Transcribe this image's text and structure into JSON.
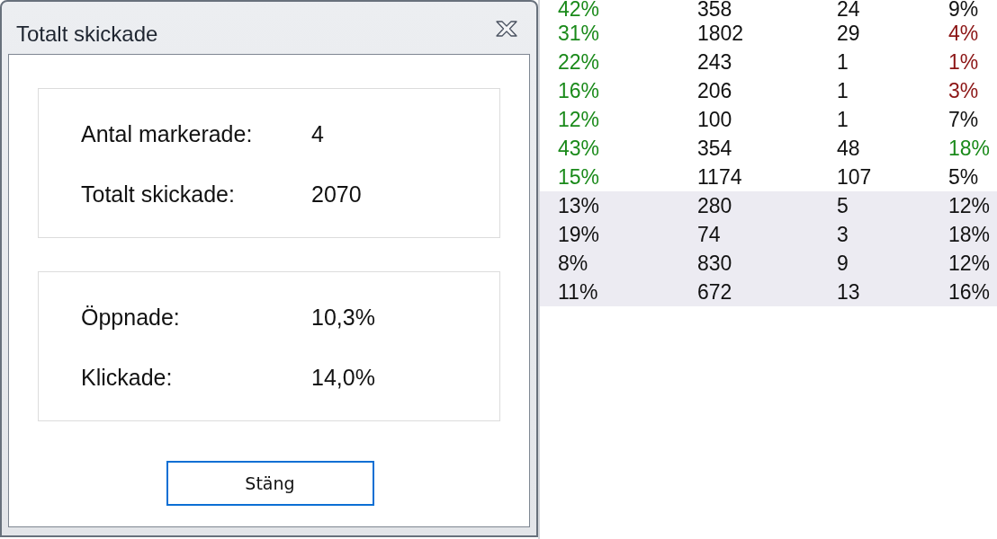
{
  "dialog": {
    "title": "Totalt skickade",
    "groups": [
      {
        "fields": [
          {
            "label": "Antal markerade:",
            "value": "4"
          },
          {
            "label": "Totalt skickade:",
            "value": "2070"
          }
        ]
      },
      {
        "fields": [
          {
            "label": "Öppnade:",
            "value": "10,3%"
          },
          {
            "label": "Klickade:",
            "value": "14,0%"
          }
        ]
      }
    ],
    "buttons": [
      {
        "label": "Stäng",
        "focused": true
      }
    ]
  },
  "table": {
    "rows": [
      {
        "selected": false,
        "cells": [
          {
            "text": "42%",
            "color": "#1a8a1a"
          },
          {
            "text": "358",
            "color": "#111111"
          },
          {
            "text": "24",
            "color": "#111111"
          },
          {
            "text": "9%",
            "color": "#111111"
          }
        ]
      },
      {
        "selected": false,
        "cells": [
          {
            "text": "31%",
            "color": "#1a8a1a"
          },
          {
            "text": "1802",
            "color": "#111111"
          },
          {
            "text": "29",
            "color": "#111111"
          },
          {
            "text": "4%",
            "color": "#8b1414"
          }
        ]
      },
      {
        "selected": false,
        "cells": [
          {
            "text": "22%",
            "color": "#1a8a1a"
          },
          {
            "text": "243",
            "color": "#111111"
          },
          {
            "text": "1",
            "color": "#111111"
          },
          {
            "text": "1%",
            "color": "#8b1414"
          }
        ]
      },
      {
        "selected": false,
        "cells": [
          {
            "text": "16%",
            "color": "#1a8a1a"
          },
          {
            "text": "206",
            "color": "#111111"
          },
          {
            "text": "1",
            "color": "#111111"
          },
          {
            "text": "3%",
            "color": "#8b1414"
          }
        ]
      },
      {
        "selected": false,
        "cells": [
          {
            "text": "12%",
            "color": "#1a8a1a"
          },
          {
            "text": "100",
            "color": "#111111"
          },
          {
            "text": "1",
            "color": "#111111"
          },
          {
            "text": "7%",
            "color": "#111111"
          }
        ]
      },
      {
        "selected": false,
        "cells": [
          {
            "text": "43%",
            "color": "#1a8a1a"
          },
          {
            "text": "354",
            "color": "#111111"
          },
          {
            "text": "48",
            "color": "#111111"
          },
          {
            "text": "18%",
            "color": "#1a8a1a"
          }
        ]
      },
      {
        "selected": false,
        "cells": [
          {
            "text": "15%",
            "color": "#1a8a1a"
          },
          {
            "text": "1174",
            "color": "#111111"
          },
          {
            "text": "107",
            "color": "#111111"
          },
          {
            "text": "5%",
            "color": "#111111"
          }
        ]
      },
      {
        "selected": true,
        "cells": [
          {
            "text": "13%",
            "color": "#111111"
          },
          {
            "text": "280",
            "color": "#111111"
          },
          {
            "text": "5",
            "color": "#111111"
          },
          {
            "text": "12%",
            "color": "#111111"
          }
        ]
      },
      {
        "selected": true,
        "cells": [
          {
            "text": "19%",
            "color": "#111111"
          },
          {
            "text": "74",
            "color": "#111111"
          },
          {
            "text": "3",
            "color": "#111111"
          },
          {
            "text": "18%",
            "color": "#111111"
          }
        ]
      },
      {
        "selected": true,
        "cells": [
          {
            "text": "8%",
            "color": "#111111"
          },
          {
            "text": "830",
            "color": "#111111"
          },
          {
            "text": "9",
            "color": "#111111"
          },
          {
            "text": "12%",
            "color": "#111111"
          }
        ]
      },
      {
        "selected": true,
        "cells": [
          {
            "text": "11%",
            "color": "#111111"
          },
          {
            "text": "672",
            "color": "#111111"
          },
          {
            "text": "13",
            "color": "#111111"
          },
          {
            "text": "16%",
            "color": "#111111"
          }
        ]
      }
    ]
  }
}
